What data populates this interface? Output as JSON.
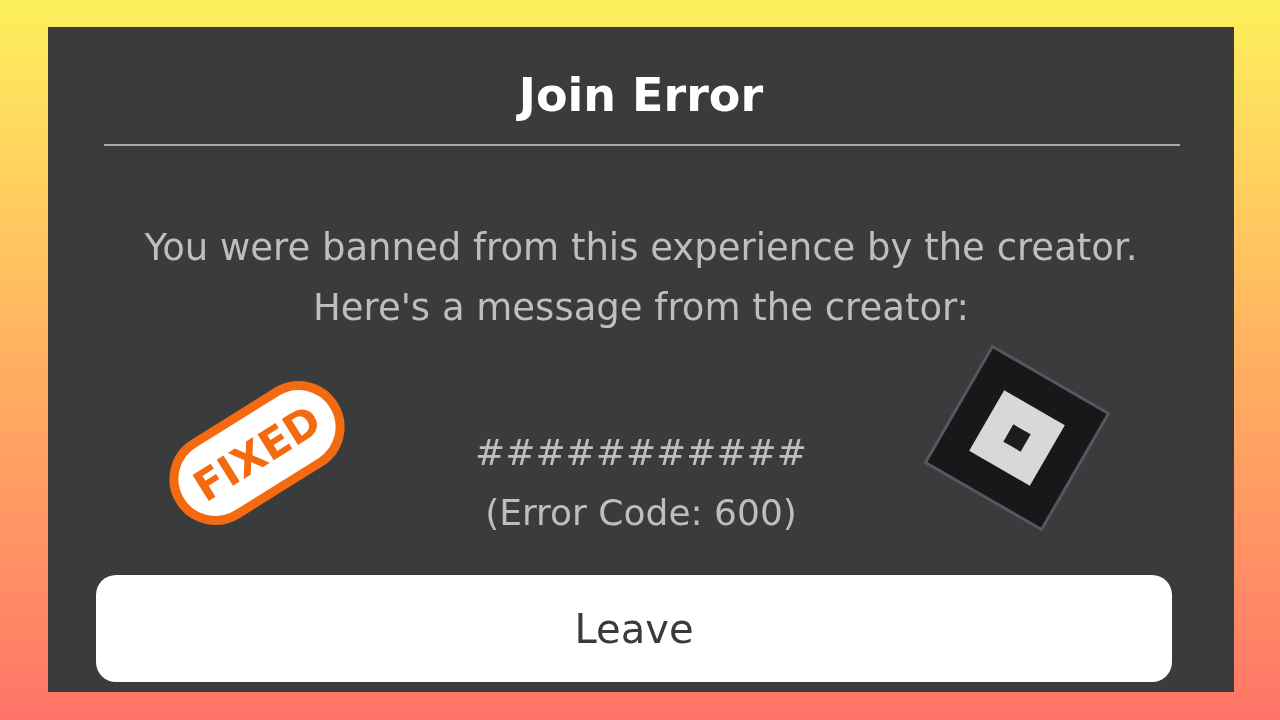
{
  "dialog": {
    "title": "Join Error",
    "message_lines": [
      "You were banned from this experience by the creator.",
      "Here's a message from the creator:"
    ],
    "creator_message": "###########",
    "error_code": "(Error Code: 600)",
    "buttons": [
      "Leave"
    ]
  },
  "sticker": {
    "label": "FIXED"
  }
}
